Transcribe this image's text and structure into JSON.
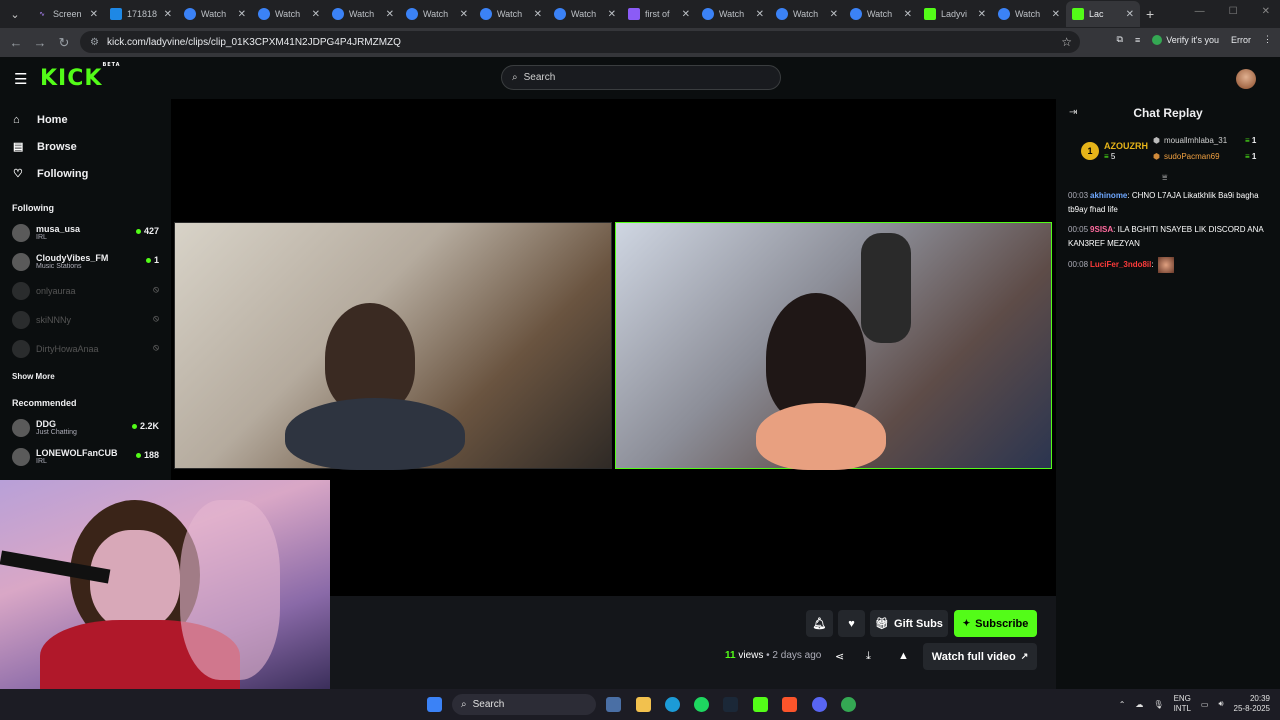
{
  "browser": {
    "tabs": [
      {
        "label": "Screen",
        "icon": "screencast-icon"
      },
      {
        "label": "171818",
        "icon": "image-icon"
      },
      {
        "label": "Watch",
        "icon": "watch-icon"
      },
      {
        "label": "Watch",
        "icon": "watch-icon"
      },
      {
        "label": "Watch",
        "icon": "watch-icon"
      },
      {
        "label": "Watch",
        "icon": "watch-icon"
      },
      {
        "label": "Watch",
        "icon": "watch-icon"
      },
      {
        "label": "Watch",
        "icon": "watch-icon"
      },
      {
        "label": "first of",
        "icon": "doc-icon"
      },
      {
        "label": "Watch",
        "icon": "watch-icon"
      },
      {
        "label": "Watch",
        "icon": "watch-icon"
      },
      {
        "label": "Watch",
        "icon": "watch-icon"
      },
      {
        "label": "Ladyvi",
        "icon": "kick-icon"
      },
      {
        "label": "Watch",
        "icon": "watch-icon"
      },
      {
        "label": "Lac",
        "icon": "kick-icon"
      }
    ],
    "url": "kick.com/ladyvine/clips/clip_01K3CPXM41N2JDPG4P4JRMZMZQ",
    "verify_label": "Verify it's you",
    "error_label": "Error"
  },
  "kick": {
    "logo": "KICK",
    "logo_badge": "BETA",
    "search_placeholder": "Search",
    "nav": [
      {
        "label": "Home",
        "icon": "home-icon"
      },
      {
        "label": "Browse",
        "icon": "browse-icon"
      },
      {
        "label": "Following",
        "icon": "heart-icon"
      }
    ],
    "following_title": "Following",
    "following": [
      {
        "name": "musa_usa",
        "sub": "IRL",
        "count": "427",
        "live": true
      },
      {
        "name": "CloudyVibes_FM",
        "sub": "Music Stations",
        "count": "1",
        "live": true
      },
      {
        "name": "onlyauraa",
        "sub": "",
        "count": "",
        "live": false
      },
      {
        "name": "skiNNNy",
        "sub": "",
        "count": "",
        "live": false
      },
      {
        "name": "DirtyHowaAnaa",
        "sub": "",
        "count": "",
        "live": false
      }
    ],
    "show_more": "Show More",
    "recommended_title": "Recommended",
    "recommended": [
      {
        "name": "DDG",
        "sub": "Just Chatting",
        "count": "2.2K"
      },
      {
        "name": "LONEWOLFanCUB",
        "sub": "IRL",
        "count": "188"
      }
    ]
  },
  "clip": {
    "gift_label": "Gift Subs",
    "subscribe_label": "Subscribe",
    "views_count": "11",
    "views_word": "views",
    "age": "• 2 days ago",
    "watch_full": "Watch full video"
  },
  "chat": {
    "title": "Chat Replay",
    "top_gifter": {
      "rank": "1",
      "name": "AZOUZRH",
      "count": "5"
    },
    "gifters": [
      {
        "name": "mouallmhlaba_31",
        "count": "1"
      },
      {
        "name": "sudoPacman69",
        "count": "1"
      }
    ],
    "messages": [
      {
        "ts": "00:03",
        "user": "akhinome",
        "color": "#6fa8ff",
        "text": ": CHNO L7AJA Likatkhlik Ba9i bagha tb9ay fhad life"
      },
      {
        "ts": "00:05",
        "user": "9SISA",
        "color": "#ff6b9e",
        "text": ": ILA BGHITI NSAYEB LIK DISCORD ANA KAN3REF MEZYAN"
      },
      {
        "ts": "00:08",
        "user": "LuciFer_3ndo8il",
        "color": "#ff3b3b",
        "text": ":"
      }
    ]
  },
  "taskbar": {
    "search_label": "Search",
    "lang_top": "ENG",
    "lang_bottom": "INTL",
    "time": "20:39",
    "date": "25-8-2025"
  },
  "colors": {
    "accent": "#53fc18",
    "gold": "#e6b419",
    "bg": "#0b0e0f"
  }
}
